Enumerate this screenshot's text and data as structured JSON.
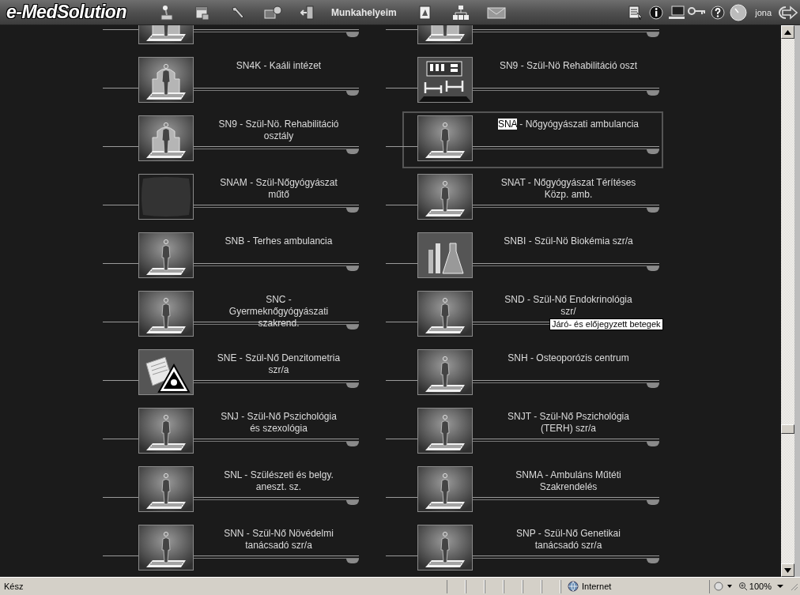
{
  "toolbar": {
    "logo": "e-MedSolution",
    "items": [
      {
        "kind": "joystick"
      },
      {
        "kind": "calendar"
      },
      {
        "kind": "wrench"
      },
      {
        "kind": "monitor"
      },
      {
        "kind": "door"
      },
      {
        "kind": "label",
        "text": "Munkahelyeim"
      },
      {
        "kind": "pdf"
      },
      {
        "kind": "tree"
      },
      {
        "kind": "mail"
      }
    ],
    "right_items": [
      {
        "kind": "list"
      },
      {
        "kind": "info"
      },
      {
        "kind": "computer"
      },
      {
        "kind": "key"
      },
      {
        "kind": "help"
      },
      {
        "kind": "clock"
      },
      {
        "kind": "label",
        "text": "jona"
      },
      {
        "kind": "exit"
      }
    ]
  },
  "tiles": [
    {
      "kind": "rehab",
      "selected": false
    },
    {
      "kind": "rehab",
      "selected": false
    },
    {
      "kind": "rehab",
      "label": "SN4K - Kaáli intézet",
      "selected": false
    },
    {
      "kind": "beds",
      "label": "SN9 - Szül-Nö Rehabilitáció oszt",
      "selected": false
    },
    {
      "kind": "rehab",
      "label": "SN9 - Szül-Nö. Rehabilitáció osztály",
      "selected": false
    },
    {
      "kind": "person",
      "label_highlight": "SNA",
      "label": " - Nőgyógyászati ambulancia",
      "selected": true
    },
    {
      "kind": "blank",
      "label": "SNAM - Szül-Nőgyógyászat műtő",
      "selected": false
    },
    {
      "kind": "person",
      "label": "SNAT - Nőgyógyászat Térítéses Közp. amb.",
      "selected": false
    },
    {
      "kind": "person",
      "label": "SNB - Terhes ambulancia",
      "selected": false
    },
    {
      "kind": "lab",
      "label": "SNBI - Szül-Nö Biokémia szr/a",
      "selected": false
    },
    {
      "kind": "person",
      "label": "SNC - Gyermeknőgyógyászati szakrend.",
      "selected": false
    },
    {
      "kind": "person",
      "label": "SND - Szül-Nő Endokrinológia szr/",
      "selected": false,
      "tooltip": "Járó- és előjegyzett betegek"
    },
    {
      "kind": "radiation",
      "label": "SNE - Szül-Nő Denzitometria szr/a",
      "selected": false
    },
    {
      "kind": "person",
      "label": "SNH - Osteoporózis centrum",
      "selected": false
    },
    {
      "kind": "person",
      "label": "SNJ - Szül-Nő Pszichológia és szexológia",
      "selected": false
    },
    {
      "kind": "person",
      "label": "SNJT - Szül-Nő Pszichológia (TERH) szr/a",
      "selected": false
    },
    {
      "kind": "person",
      "label": "SNL - Szülészeti és belgy. aneszt. sz.",
      "selected": false
    },
    {
      "kind": "person",
      "label": "SNMA - Ambuláns Műtéti Szakrendelés",
      "selected": false
    },
    {
      "kind": "person",
      "label": "SNN - Szül-Nő Növédelmi tanácsadó szr/a",
      "selected": false
    },
    {
      "kind": "person",
      "label": "SNP - Szül-Nő Genetikai tanácsadó szr/a",
      "selected": false
    }
  ],
  "status_bar": {
    "status": "Kész",
    "zone": "Internet",
    "zoom": "100%"
  }
}
